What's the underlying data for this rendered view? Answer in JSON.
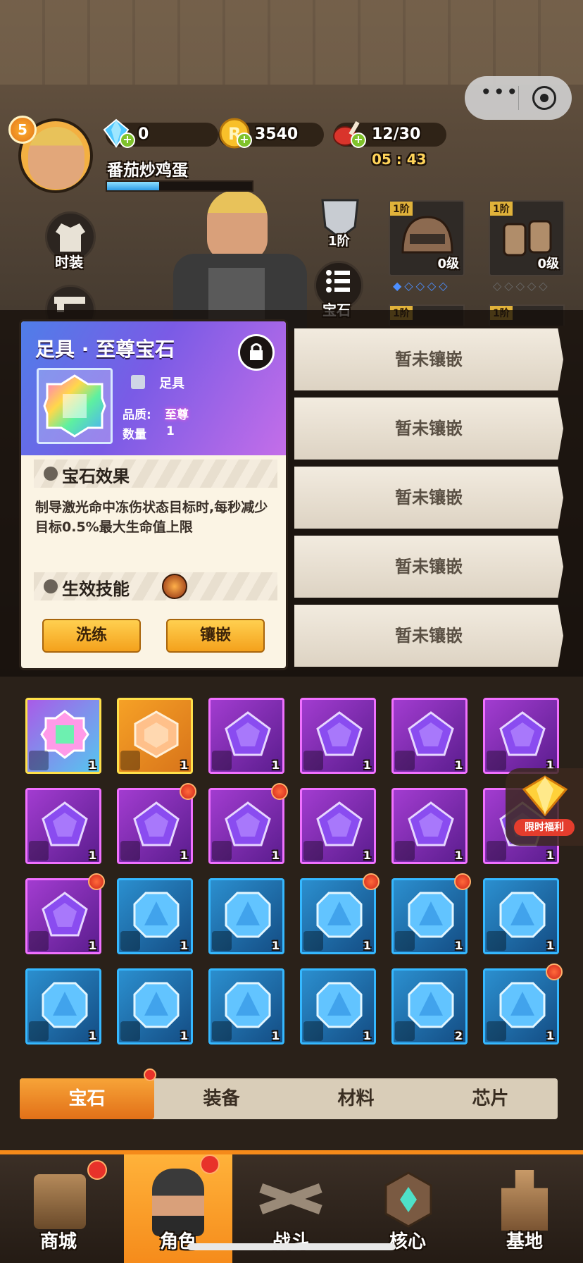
{
  "hud": {
    "player_level": "5",
    "player_name": "番茄炒鸡蛋",
    "diamonds": "0",
    "coins": "3540",
    "stamina": "12/30",
    "stamina_timer": "05 : 43"
  },
  "left_menu": {
    "fashion_label": "时装"
  },
  "equipment": {
    "chest_tier": "1阶",
    "helmet_tier": "1阶",
    "helmet_level": "0级",
    "gloves_tier": "1阶",
    "gloves_level": "0级",
    "gem_button_label": "宝石",
    "row2_tier_left": "1阶",
    "row2_tier_right": "1阶"
  },
  "gem_detail": {
    "title": "足具 · 至尊宝石",
    "slot_label": "足具",
    "quality_label": "品质:",
    "quality_value": "至尊",
    "quantity_label": "数量",
    "quantity_value": "1",
    "effect_heading": "宝石效果",
    "effect_text": "制导激光命中冻伤状态目标时,每秒减少目标0.5%最大生命值上限",
    "skill_heading": "生效技能",
    "refine_label": "洗练",
    "inlay_label": "镶嵌"
  },
  "socket_slots": [
    "暂未镶嵌",
    "暂未镶嵌",
    "暂未镶嵌",
    "暂未镶嵌",
    "暂未镶嵌"
  ],
  "inventory": {
    "rows": [
      [
        {
          "color": "rainbow",
          "slot": "boots",
          "count": "1",
          "dot": false
        },
        {
          "color": "orange",
          "slot": "gloves",
          "count": "1",
          "dot": false
        },
        {
          "color": "purple",
          "slot": "helmet",
          "count": "1",
          "dot": false
        },
        {
          "color": "purple",
          "slot": "gloves",
          "count": "1",
          "dot": false
        },
        {
          "color": "purple",
          "slot": "gloves",
          "count": "1",
          "dot": false
        },
        {
          "color": "purple",
          "slot": "boots",
          "count": "1",
          "dot": false
        }
      ],
      [
        {
          "color": "purple",
          "slot": "boots",
          "count": "1",
          "dot": false
        },
        {
          "color": "purple",
          "slot": "weapon",
          "count": "1",
          "dot": true
        },
        {
          "color": "purple",
          "slot": "pants",
          "count": "1",
          "dot": true
        },
        {
          "color": "purple",
          "slot": "glove",
          "count": "1",
          "dot": false
        },
        {
          "color": "purple",
          "slot": "glove",
          "count": "1",
          "dot": false
        },
        {
          "color": "purple",
          "slot": "glove",
          "count": "1",
          "dot": false
        }
      ],
      [
        {
          "color": "purple",
          "slot": "glove",
          "count": "1",
          "dot": true
        },
        {
          "color": "blue",
          "slot": "helmet",
          "count": "1",
          "dot": false
        },
        {
          "color": "blue",
          "slot": "helmet",
          "count": "1",
          "dot": false
        },
        {
          "color": "blue",
          "slot": "helmet",
          "count": "1",
          "dot": true
        },
        {
          "color": "blue",
          "slot": "gloves",
          "count": "1",
          "dot": true
        },
        {
          "color": "blue",
          "slot": "gloves",
          "count": "1",
          "dot": false
        }
      ],
      [
        {
          "color": "blue",
          "slot": "gloves",
          "count": "1",
          "dot": false
        },
        {
          "color": "blue",
          "slot": "gloves",
          "count": "1",
          "dot": false
        },
        {
          "color": "blue",
          "slot": "boots",
          "count": "1",
          "dot": false
        },
        {
          "color": "blue",
          "slot": "weapon",
          "count": "1",
          "dot": false
        },
        {
          "color": "blue",
          "slot": "weapon",
          "count": "2",
          "dot": false
        },
        {
          "color": "blue",
          "slot": "pants",
          "count": "1",
          "dot": true
        }
      ]
    ]
  },
  "limited_offer_label": "限时福利",
  "tabs": [
    "宝石",
    "装备",
    "材料",
    "芯片"
  ],
  "nav": [
    "商城",
    "角色",
    "战斗",
    "核心",
    "基地"
  ]
}
